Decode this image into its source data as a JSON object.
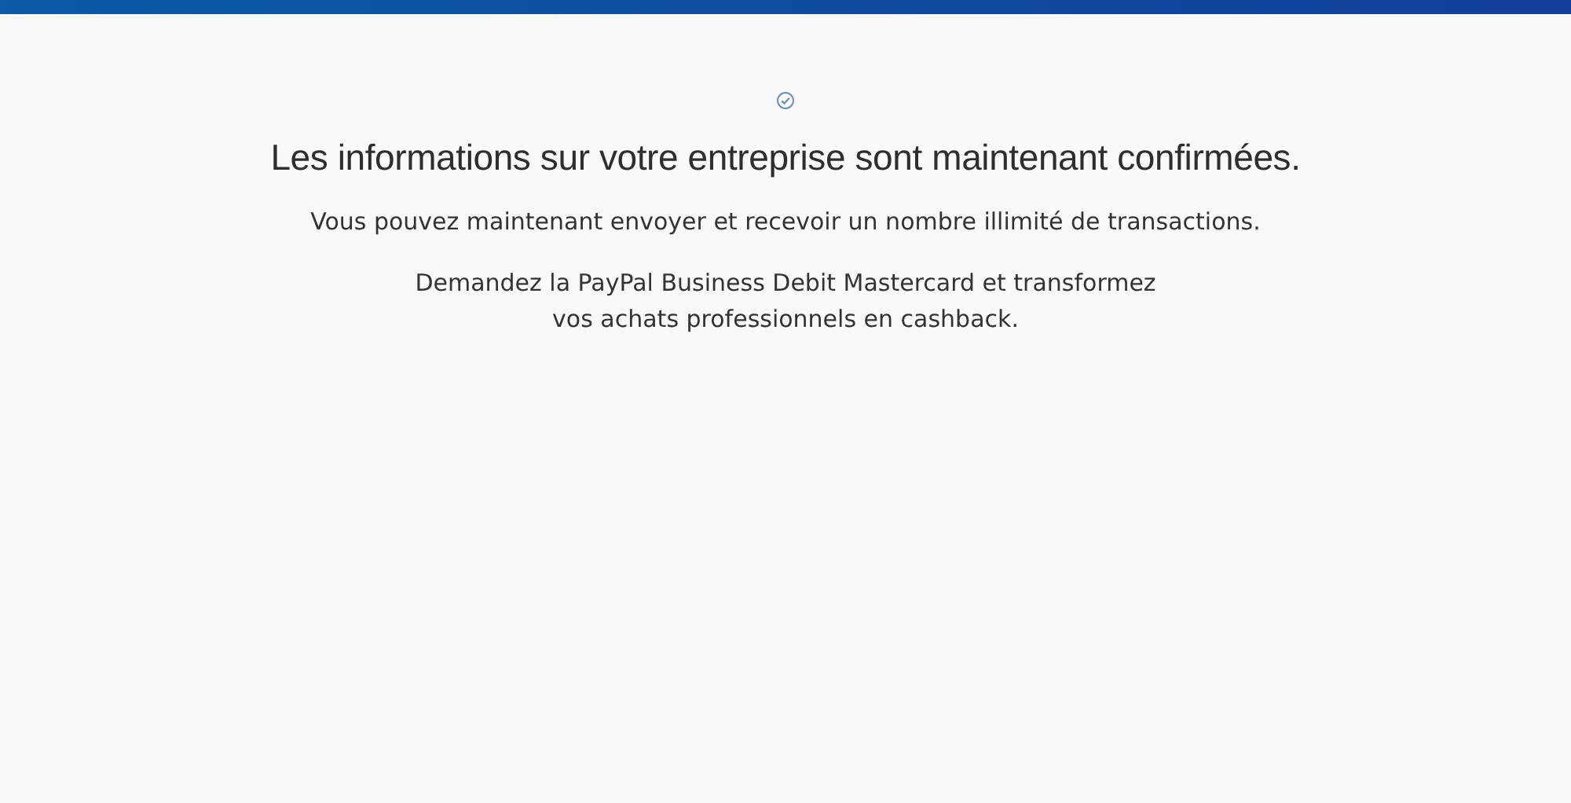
{
  "heading": "Les informations sur votre entreprise sont maintenant confirmées.",
  "paragraphs": [
    "Vous pouvez maintenant envoyer et recevoir un nombre illimité de transactions.",
    "Demandez la PayPal Business Debit Mastercard et transformez\nvos achats professionnels en cashback."
  ]
}
